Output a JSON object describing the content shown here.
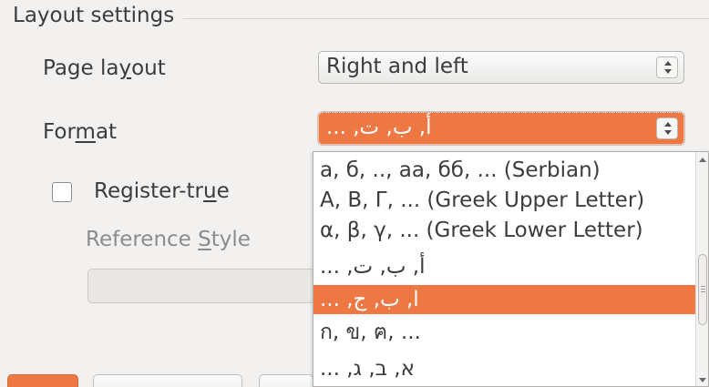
{
  "section": {
    "title": "Layout settings"
  },
  "page_layout": {
    "label_pre": "Page la",
    "label_mn": "y",
    "label_post": "out",
    "value": "Right and left"
  },
  "format": {
    "label_pre": "For",
    "label_mn": "m",
    "label_post": "at",
    "value": "أ, ب, ت, ..."
  },
  "register_true": {
    "label_pre": "Register-tr",
    "label_mn": "u",
    "label_post": "e",
    "checked": false
  },
  "reference_style": {
    "label_pre": "Reference ",
    "label_mn": "S",
    "label_post": "tyle"
  },
  "dropdown": {
    "items": [
      {
        "label": "а, б, .., аа, бб, ... (Serbian)",
        "rtl": false,
        "selected": false
      },
      {
        "label": "Α, Β, Γ, ... (Greek Upper Letter)",
        "rtl": false,
        "selected": false
      },
      {
        "label": "α, β, γ, ... (Greek Lower Letter)",
        "rtl": false,
        "selected": false
      },
      {
        "label": "أ, ب, ت, ...",
        "rtl": true,
        "selected": false
      },
      {
        "label": "ا, ب, ج, ...",
        "rtl": true,
        "selected": true
      },
      {
        "label": "ก, ข, ฅ, ...",
        "rtl": false,
        "selected": false
      },
      {
        "label": "א, ב, ג, ...",
        "rtl": true,
        "selected": false
      }
    ]
  },
  "colors": {
    "accent": "#ee7844",
    "background": "#f2f1f0",
    "text": "#3c3c3c"
  }
}
